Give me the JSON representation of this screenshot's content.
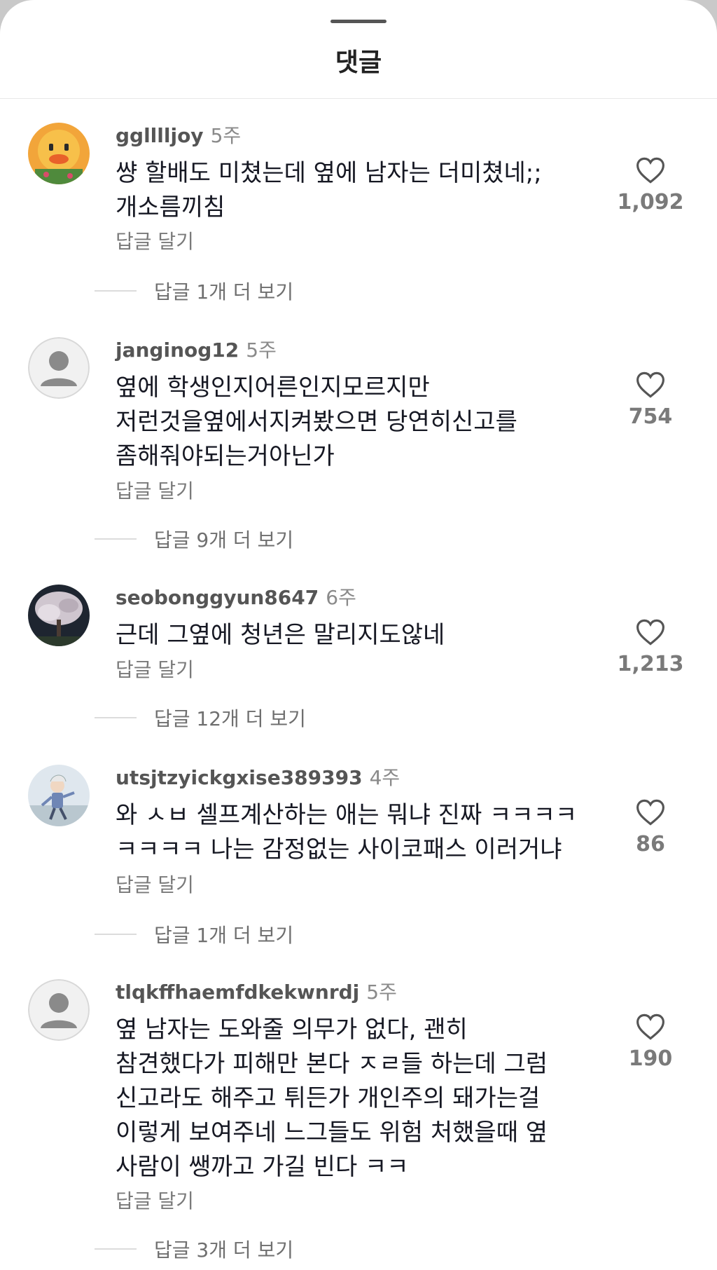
{
  "header": {
    "title": "댓글"
  },
  "comments": [
    {
      "username": "gglllljoy",
      "time": "5주",
      "lines": [
        "썅 할배도 미쳤는데 옆에 남자는 더미쳤네;;",
        "개소름끼침"
      ],
      "reply_label": "답글 달기",
      "likes": "1,092",
      "more_replies": "답글 1개 더 보기",
      "avatar": "duck-character-avatar"
    },
    {
      "username": "janginog12",
      "time": "5주",
      "lines": [
        "옆에 학생인지어른인지모르지만",
        "저런것을옆에서지켜봤으면 당연히신고를",
        "좀해줘야되는거아닌가"
      ],
      "reply_label": "답글 달기",
      "likes": "754",
      "more_replies": "답글 9개 더 보기",
      "avatar": "default-person-avatar"
    },
    {
      "username": "seobonggyun8647",
      "time": "6주",
      "lines": [
        "근데 그옆에 청년은 말리지도않네"
      ],
      "reply_label": "답글 달기",
      "likes": "1,213",
      "more_replies": "답글 12개 더 보기",
      "avatar": "cherry-blossom-tree-avatar"
    },
    {
      "username": "utsjtzyickgxise389393",
      "time": "4주",
      "lines": [
        "와 ㅅㅂ 셀프계산하는 애는 뭐냐 진짜 ㅋㅋㅋㅋ",
        "ㅋㅋㅋㅋ 나는 감정없는 사이코패스 이러거냐"
      ],
      "reply_label": "답글 달기",
      "likes": "86",
      "more_replies": "답글 1개 더 보기",
      "avatar": "illustrated-character-avatar"
    },
    {
      "username": "tlqkffhaemfdkekwnrdj",
      "time": "5주",
      "lines": [
        "옆 남자는 도와줄 의무가 없다, 괜히",
        "참견했다가 피해만 본다 ㅈㄹ들 하는데 그럼",
        "신고라도 해주고 튀든가 개인주의 돼가는걸",
        "이렇게 보여주네 느그들도 위험 처했을때 옆",
        "사람이 쌩까고 가길 빈다 ㅋㅋ"
      ],
      "reply_label": "답글 달기",
      "likes": "190",
      "more_replies": "답글 3개 더 보기",
      "avatar": "default-person-avatar"
    }
  ],
  "icons": {
    "like": "heart-outline-icon"
  },
  "colors": {
    "text": "#161823",
    "secondary": "#7a7a7a",
    "background": "#ffffff"
  }
}
